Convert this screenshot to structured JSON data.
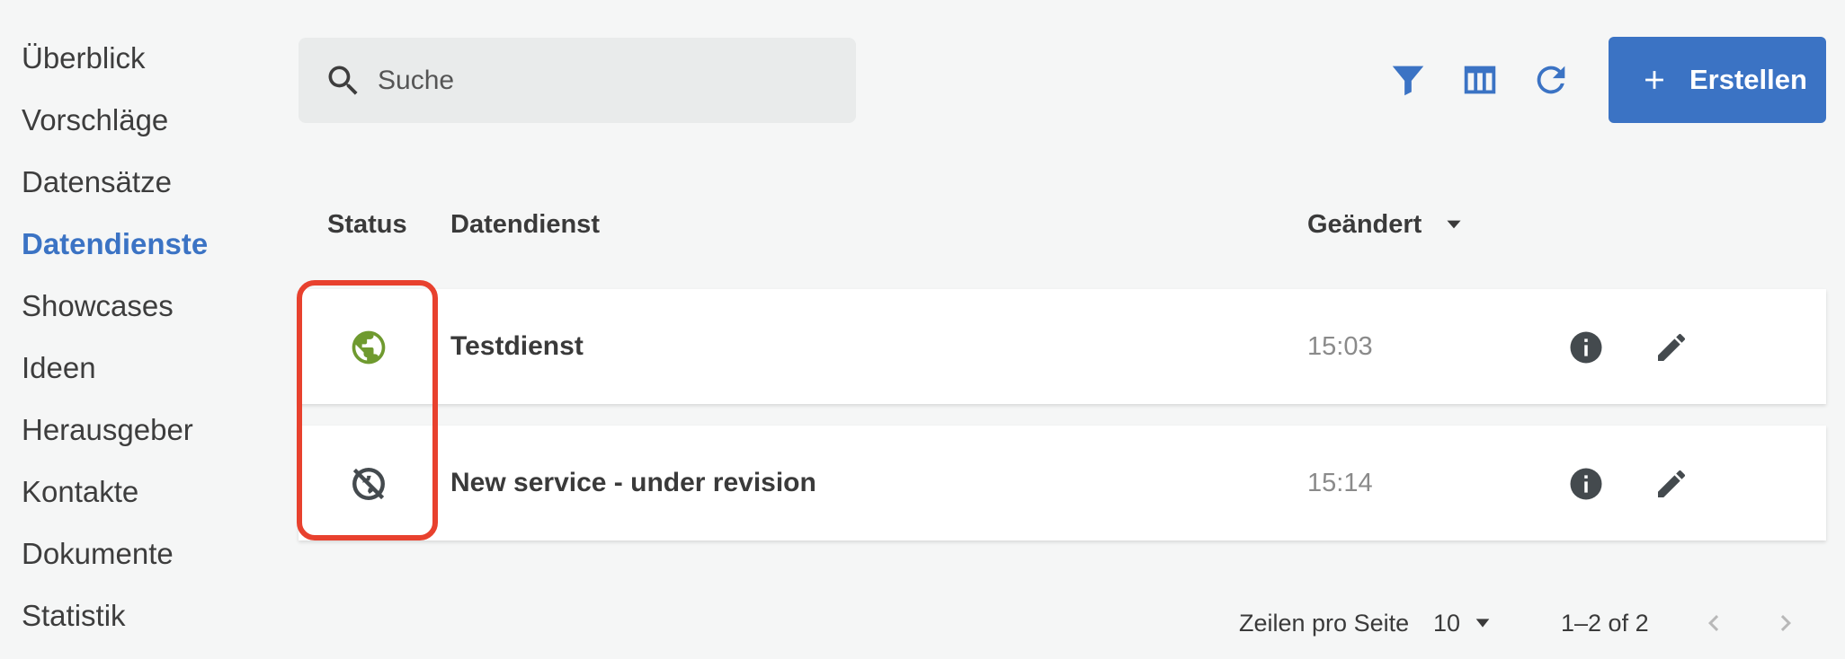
{
  "sidebar": {
    "items": [
      {
        "label": "Überblick",
        "active": false
      },
      {
        "label": "Vorschläge",
        "active": false
      },
      {
        "label": "Datensätze",
        "active": false
      },
      {
        "label": "Datendienste",
        "active": true
      },
      {
        "label": "Showcases",
        "active": false
      },
      {
        "label": "Ideen",
        "active": false
      },
      {
        "label": "Herausgeber",
        "active": false
      },
      {
        "label": "Kontakte",
        "active": false
      },
      {
        "label": "Dokumente",
        "active": false
      },
      {
        "label": "Statistik",
        "active": false
      }
    ]
  },
  "search": {
    "placeholder": "Suche",
    "value": "",
    "icon": "search-icon"
  },
  "toolbar": {
    "icons": [
      "filter-icon",
      "columns-icon",
      "refresh-icon"
    ],
    "create_label": "Erstellen"
  },
  "table": {
    "columns": {
      "status": "Status",
      "name": "Datendienst",
      "changed": "Geändert"
    },
    "sort": "descending",
    "rows": [
      {
        "status": "published",
        "status_icon": "globe-icon",
        "name": "Testdienst",
        "changed": "15:03"
      },
      {
        "status": "unpublished",
        "status_icon": "globe-off-icon",
        "name": "New service - under revision",
        "changed": "15:14"
      }
    ]
  },
  "pagination": {
    "rows_per_page_label": "Zeilen pro Seite",
    "rows_per_page": "10",
    "range": "1–2 of 2"
  },
  "colors": {
    "accent": "#3b73c4",
    "published": "#6f9a2f",
    "highlight": "#e8412e",
    "icon_dark": "#444a4e"
  }
}
